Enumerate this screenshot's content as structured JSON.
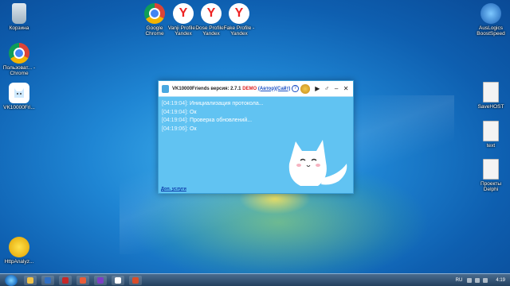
{
  "desktop": {
    "icons_left": [
      {
        "label": "Корзина",
        "icon": "recycle-bin-icon"
      },
      {
        "label": "Пользоват... - Chrome",
        "icon": "chrome-icon"
      },
      {
        "label": "VK10000Fri...",
        "icon": "cat-icon"
      },
      {
        "label": "HttpAnalyz...",
        "icon": "https-analyzer-icon"
      }
    ],
    "icons_top": [
      {
        "label": "Google Chrome",
        "icon": "chrome-icon"
      },
      {
        "label": "Vanji Profile - Yandex",
        "icon": "yandex-icon"
      },
      {
        "label": "Dose Profile - Yandex",
        "icon": "yandex-icon"
      },
      {
        "label": "Fake Profile - Yandex",
        "icon": "yandex-icon"
      }
    ],
    "icons_right": [
      {
        "label": "AusLogics BoostSpeed",
        "icon": "boostspeed-icon"
      },
      {
        "label": "SaveHOST",
        "icon": "file-icon"
      },
      {
        "label": "text",
        "icon": "file-icon"
      },
      {
        "label": "Проекты Delphi",
        "icon": "file-icon"
      }
    ]
  },
  "app": {
    "title_prefix": "VK10000Friends версия: 2.7.1",
    "title_demo": "DEMO",
    "title_author": "(Автор)",
    "title_site": "(Сайт)",
    "help_glyph": "?",
    "play_glyph": "▶",
    "settings_glyph": "♂",
    "minimize_glyph": "–",
    "close_glyph": "✕",
    "log": [
      {
        "time": "[04:19:04]:",
        "text": "Инициализация протокола..."
      },
      {
        "time": "[04:19:04]:",
        "text": "Ок"
      },
      {
        "time": "[04:19:04]:",
        "text": "Проверка обновлений..."
      },
      {
        "time": "[04:19:06]:",
        "text": "Ок"
      }
    ],
    "bottom_link": "Доп. услуги"
  },
  "taskbar": {
    "lang": "RU",
    "clock": "4:19"
  }
}
